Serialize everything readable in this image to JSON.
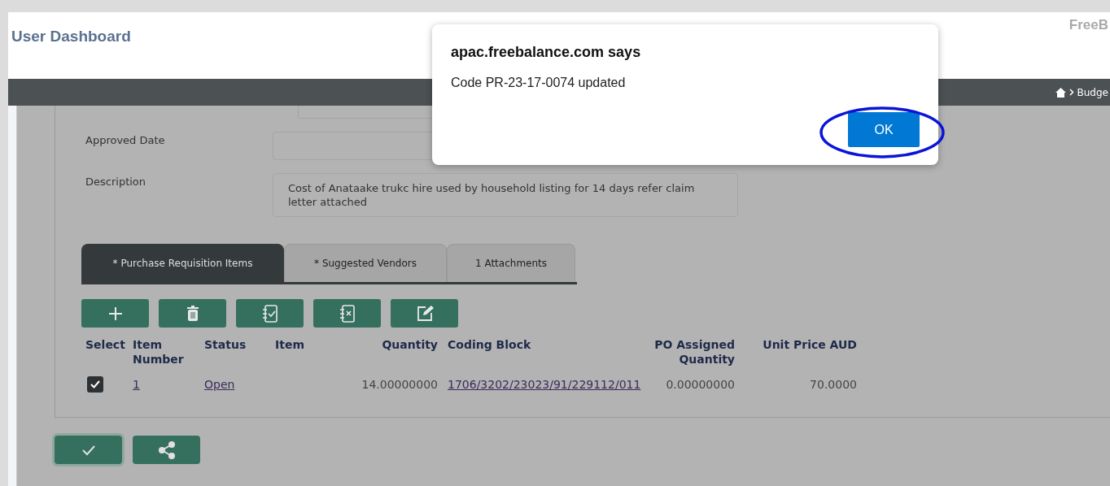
{
  "header": {
    "title": "User Dashboard",
    "brand": "FreeB",
    "breadcrumb": "Budge"
  },
  "form": {
    "fields": [
      {
        "label": "Approved Date"
      },
      {
        "label": "Description",
        "value": "Cost of Anataake trukc hire used by household listing for 14 days refer claim letter attached",
        "kind": "textarea"
      }
    ]
  },
  "tabs": [
    {
      "label": "* Purchase Requisition Items",
      "selected": true
    },
    {
      "label": "* Suggested Vendors",
      "selected": false
    },
    {
      "label": "1 Attachments",
      "selected": false
    }
  ],
  "toolbar": [
    {
      "kind": "add"
    },
    {
      "kind": "delete"
    },
    {
      "kind": "check"
    },
    {
      "kind": "uncheck"
    },
    {
      "kind": "edit"
    }
  ],
  "table": {
    "columns": [
      "Select",
      "Item Number",
      "Status",
      "Item",
      "Quantity",
      "Coding Block",
      "PO Assigned Quantity",
      "Unit Price AUD"
    ],
    "rows": [
      {
        "selected": true,
        "item_number": "1",
        "status": "Open",
        "quantity": "14.00000000",
        "coding_block": "1706/3202/23023/91/229112/011",
        "po_assigned_quantity": "0.00000000",
        "unit_price": "70.0000"
      }
    ]
  },
  "footer_buttons": [
    {
      "kind": "confirm",
      "focused": true
    },
    {
      "kind": "share",
      "focused": false
    }
  ],
  "dialog": {
    "title": "apac.freebalance.com says",
    "message": "Code PR-23-17-0074 updated",
    "button": "OK",
    "highlighted": true
  }
}
